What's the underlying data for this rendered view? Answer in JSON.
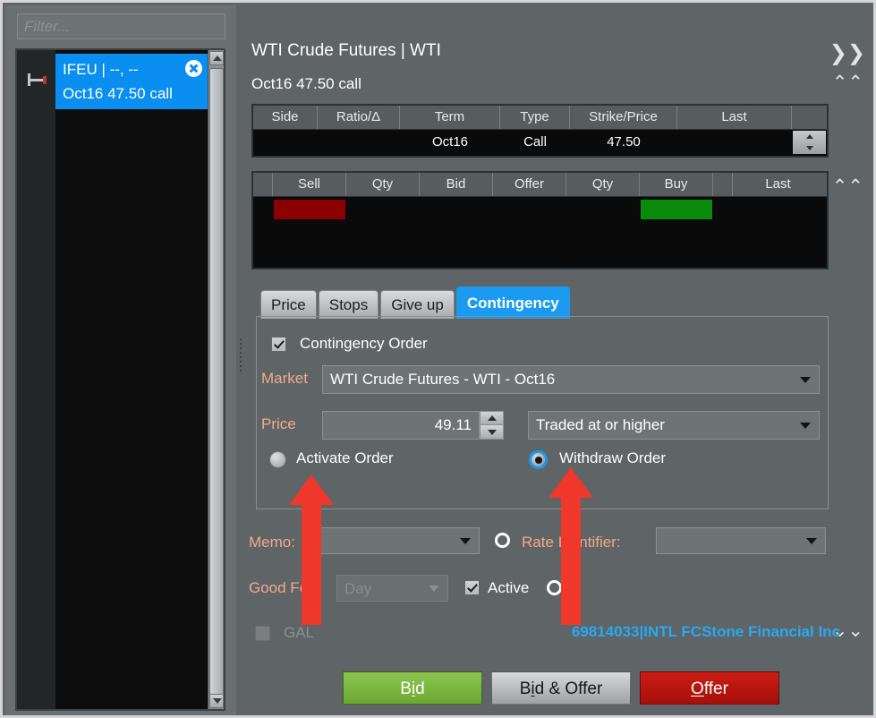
{
  "sidebar": {
    "filter_placeholder": "Filter...",
    "item": {
      "line1": "IFEU | --, --",
      "line2": "Oct16 47.50 call",
      "close_label": "✕"
    }
  },
  "header": {
    "instrument": "WTI Crude Futures | WTI",
    "contract": "Oct16 47.50 call",
    "expand_icon": "❯❯",
    "collapse_icon": "⌃⌃",
    "expand_down_icon": "⌄⌄"
  },
  "legs_table": {
    "columns": [
      "Side",
      "Ratio/Δ",
      "Term",
      "Type",
      "Strike/Price",
      "Last",
      ""
    ],
    "rows": [
      {
        "side": "",
        "ratio": "",
        "term": "Oct16",
        "type": "Call",
        "strike": "47.50",
        "last": ""
      }
    ]
  },
  "depth_table": {
    "columns": [
      "",
      "Sell",
      "Qty",
      "Bid",
      "Offer",
      "Qty",
      "Buy",
      "",
      "Last"
    ],
    "rows": [
      {
        "sell_filled": true,
        "qty1": "",
        "bid": "",
        "offer": "",
        "qty2": "",
        "buy_filled": true,
        "last": ""
      }
    ],
    "sell_color": "#8b0000",
    "buy_color": "#0a8a0a"
  },
  "tabs": [
    {
      "label": "Price",
      "active": false
    },
    {
      "label": "Stops",
      "active": false
    },
    {
      "label": "Give up",
      "active": false
    },
    {
      "label": "Contingency",
      "active": true
    }
  ],
  "contingency": {
    "checkbox_label": "Contingency Order",
    "checkbox_checked": true,
    "market_label": "Market",
    "market_value": "WTI Crude Futures - WTI - Oct16",
    "price_label": "Price",
    "price_value": "49.11",
    "condition_value": "Traded at or higher",
    "activate_label": "Activate Order",
    "activate_selected": false,
    "withdraw_label": "Withdraw Order",
    "withdraw_selected": true
  },
  "footer": {
    "memo_label": "Memo:",
    "memo_value": "",
    "rate_identifier_label": "Rate Identifier:",
    "rate_identifier_value": "",
    "good_for_label": "Good For:",
    "good_for_value": "Day",
    "active_label": "Active",
    "active_checked": true,
    "gal_label": "GAL",
    "gal_checked": false,
    "account": "69814033|INTL FCStone Financial Inc",
    "account_color": "#29a9ef"
  },
  "actions": {
    "bid": {
      "pre": "B",
      "key": "i",
      "post": "d"
    },
    "both": {
      "pre": "B",
      "key": "i",
      "post": "d & Offer"
    },
    "offer": {
      "pre": "",
      "key": "O",
      "post": "ffer"
    }
  },
  "annotations": {
    "arrow_color": "#f0372c",
    "count": 2
  }
}
